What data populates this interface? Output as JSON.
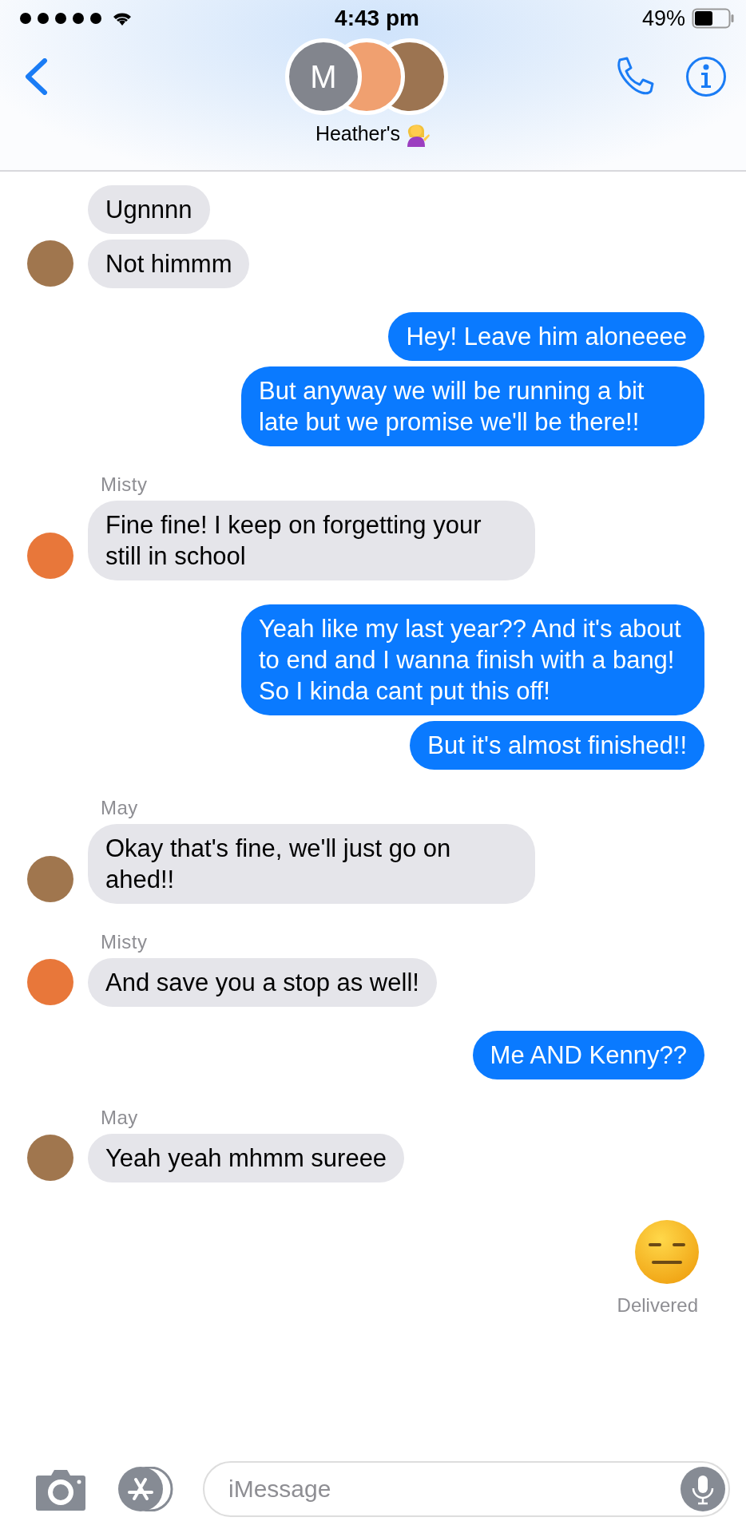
{
  "status_bar": {
    "time": "4:43 pm",
    "battery": "49%"
  },
  "header": {
    "group_initial": "M",
    "title": "Heather's"
  },
  "messages": [
    {
      "kind": "incoming",
      "text": "Ugnnnn",
      "avatar": false
    },
    {
      "kind": "incoming",
      "text": "Not himmm",
      "avatar": true,
      "color": "#a0764e"
    },
    {
      "kind": "outgoing",
      "text": "Hey! Leave him aloneeee"
    },
    {
      "kind": "outgoing",
      "text": "But anyway we will be running a bit late but we promise we'll be there!!"
    },
    {
      "kind": "sender",
      "text": "Misty"
    },
    {
      "kind": "incoming",
      "text": "Fine fine! I keep on forgetting your still in school",
      "avatar": true,
      "color": "#e8773a"
    },
    {
      "kind": "outgoing",
      "text": "Yeah like my last year?? And it's about to end and I wanna finish with a bang! So I kinda cant put this off!"
    },
    {
      "kind": "outgoing",
      "text": "But it's almost finished!!"
    },
    {
      "kind": "sender",
      "text": "May"
    },
    {
      "kind": "incoming",
      "text": "Okay that's fine, we'll just go on ahed!!",
      "avatar": true,
      "color": "#a0764e"
    },
    {
      "kind": "sender",
      "text": "Misty"
    },
    {
      "kind": "incoming",
      "text": "And save you a stop as well!",
      "avatar": true,
      "color": "#e8773a"
    },
    {
      "kind": "outgoing",
      "text": "Me AND Kenny??"
    },
    {
      "kind": "sender",
      "text": "May"
    },
    {
      "kind": "incoming",
      "text": "Yeah yeah mhmm sureee",
      "avatar": true,
      "color": "#a0764e"
    },
    {
      "kind": "emoji"
    },
    {
      "kind": "status",
      "text": "Delivered"
    }
  ],
  "composer": {
    "placeholder": "iMessage"
  }
}
